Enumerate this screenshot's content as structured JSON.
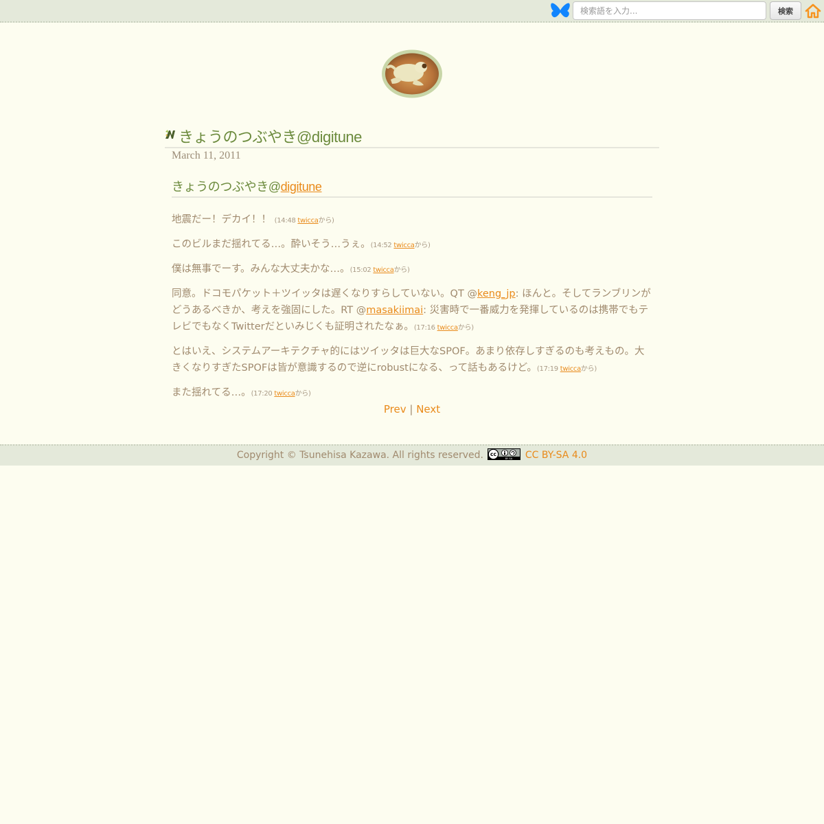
{
  "topbar": {
    "search": {
      "placeholder": "検索語を入力..."
    },
    "search_button_label": "検索",
    "icons": [
      "bluesky-butterfly-icon",
      "home-icon"
    ],
    "accent_blue": "#1185fe",
    "accent_orange": "#f7931e"
  },
  "article": {
    "title": "きょうのつぶやき@digitune",
    "date": "March 11, 2011",
    "subtitle_prefix": "きょうのつぶやき@",
    "subtitle_link": "digitune",
    "tweets": [
      {
        "text": "地震だー！デカイ！！",
        "time": "(14:48",
        "via": "twicca",
        "suffix": "から)"
      },
      {
        "text": "このビルまだ揺れてる…。酔いそう…うぇ。",
        "time": "(14:52",
        "via": "twicca",
        "suffix": "から)"
      },
      {
        "text": "僕は無事でーす。みんな大丈夫かな…。",
        "time": "(15:02",
        "via": "twicca",
        "suffix": "から)"
      },
      {
        "text_1": "同意。ドコモパケット＋ツイッタは遅くなりすらしていない。QT @",
        "link_1": "keng_jp",
        "text_2": ": ほんと。そしてランブリンがどうあるべきか、考えを強固にした。RT @",
        "link_2": "masakiimai",
        "text_3": ": 災害時で一番威力を発揮しているのは携帯でもテレビでもなくTwitterだといみじくも証明されたなぁ。",
        "time": "(17:16",
        "via": "twicca",
        "suffix": "から)"
      },
      {
        "text": "とはいえ、システムアーキテクチャ的にはツイッタは巨大なSPOF。あまり依存しすぎるのも考えもの。大きくなりすぎたSPOFは皆が意識するので逆にrobustになる、って話もあるけど。",
        "time": "(17:19",
        "via": "twicca",
        "suffix": "から)"
      },
      {
        "text": "また揺れてる…。",
        "time": "(17:20",
        "via": "twicca",
        "suffix": "から)"
      }
    ]
  },
  "pager": {
    "prev": "Prev",
    "separator": "|",
    "next": "Next"
  },
  "footer": {
    "copyright": "Copyright © Tsunehisa Kazawa. All rights reserved.",
    "license_link": "CC BY-SA 4.0",
    "badge_text": "BY SA"
  }
}
